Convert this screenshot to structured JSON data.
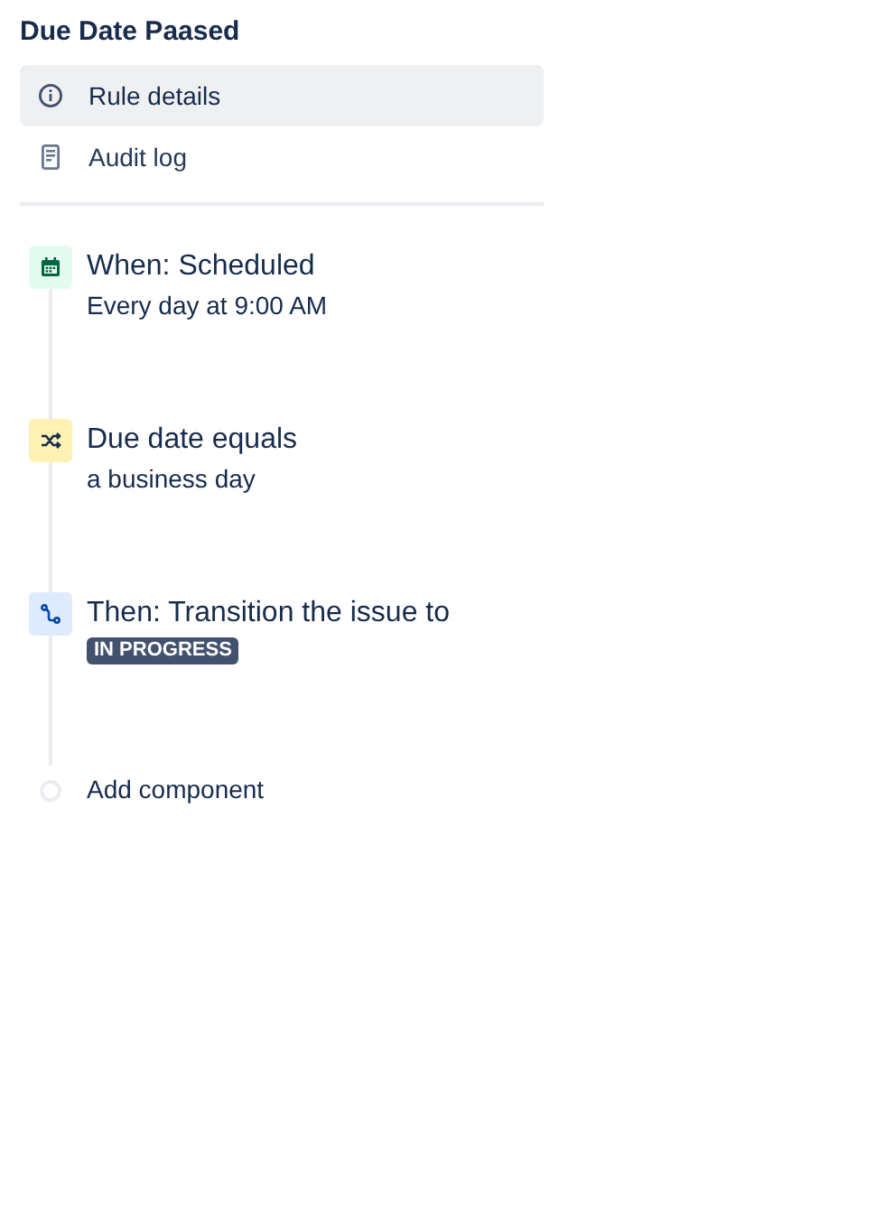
{
  "title": "Due Date Paased",
  "nav": [
    {
      "label": "Rule details",
      "kind": "info",
      "selected": true
    },
    {
      "label": "Audit log",
      "kind": "log",
      "selected": false
    }
  ],
  "steps": [
    {
      "kind": "trigger",
      "title": "When: Scheduled",
      "detail": {
        "kind": "text",
        "text": "Every day at 9:00 AM"
      }
    },
    {
      "kind": "condition",
      "title": "Due date equals",
      "detail": {
        "kind": "text",
        "text": "a business day"
      }
    },
    {
      "kind": "action",
      "title": "Then: Transition the issue to",
      "detail": {
        "kind": "lozenge",
        "text": "IN PROGRESS"
      }
    }
  ],
  "add_component": {
    "label": "Add component"
  }
}
